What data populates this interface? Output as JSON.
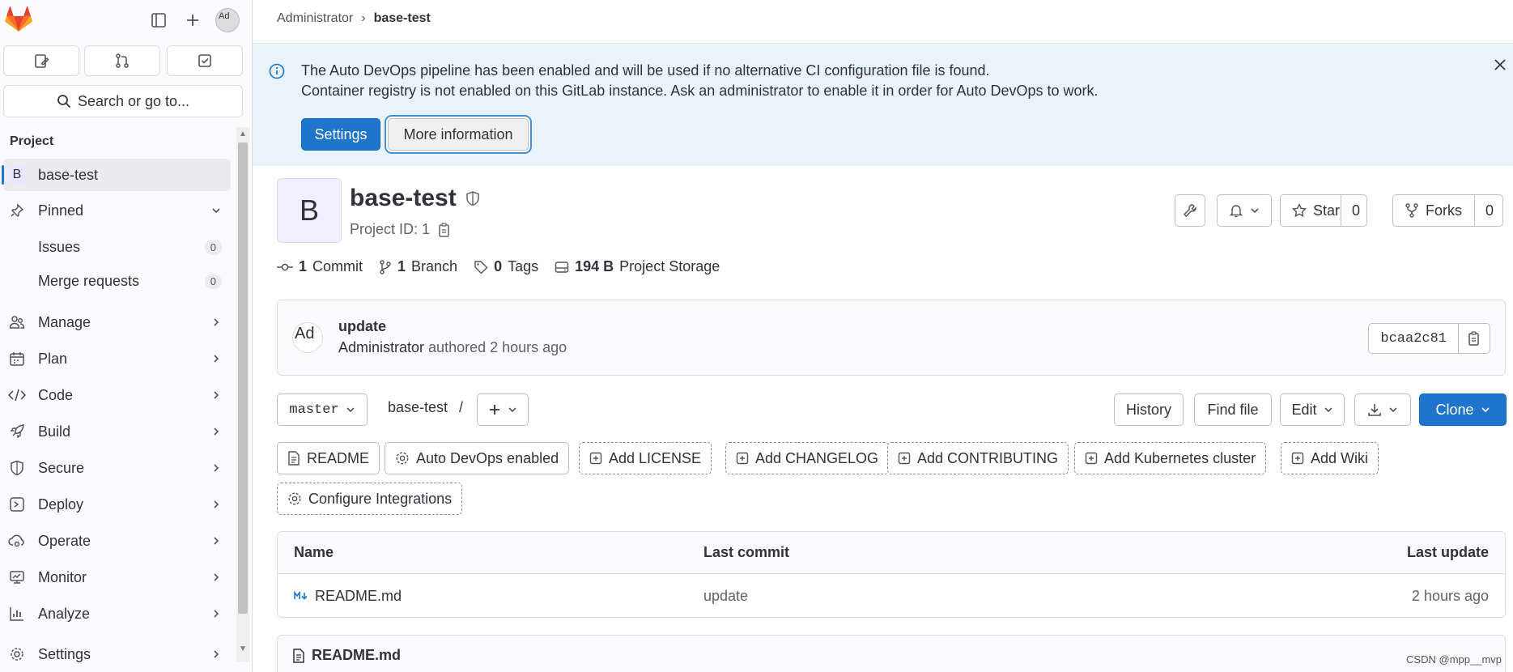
{
  "breadcrumb": {
    "parent": "Administrator",
    "separator": "›",
    "current": "base-test"
  },
  "top": {
    "avatar_alt": "Ad"
  },
  "search": {
    "label": "Search or go to..."
  },
  "sidebar": {
    "section": "Project",
    "project": {
      "letter": "B",
      "name": "base-test"
    },
    "pinned": "Pinned",
    "issues": {
      "label": "Issues",
      "count": "0"
    },
    "merge_requests": {
      "label": "Merge requests",
      "count": "0"
    },
    "items": [
      {
        "label": "Manage"
      },
      {
        "label": "Plan"
      },
      {
        "label": "Code"
      },
      {
        "label": "Build"
      },
      {
        "label": "Secure"
      },
      {
        "label": "Deploy"
      },
      {
        "label": "Operate"
      },
      {
        "label": "Monitor"
      },
      {
        "label": "Analyze"
      },
      {
        "label": "Settings"
      }
    ]
  },
  "alert": {
    "line1": "The Auto DevOps pipeline has been enabled and will be used if no alternative CI configuration file is found.",
    "line2": "Container registry is not enabled on this GitLab instance. Ask an administrator to enable it in order for Auto DevOps to work.",
    "settings_button": "Settings",
    "more_button": "More information"
  },
  "project": {
    "avatar_letter": "B",
    "name": "base-test",
    "id_label": "Project ID: 1",
    "star_label": "Star",
    "star_count": "0",
    "forks_label": "Forks",
    "forks_count": "0"
  },
  "stats": {
    "commits_n": "1",
    "commits_label": "Commit",
    "branches_n": "1",
    "branches_label": "Branch",
    "tags_n": "0",
    "tags_label": "Tags",
    "storage_n": "194 B",
    "storage_label": "Project Storage"
  },
  "last_commit": {
    "avatar_alt": "Ad",
    "title": "update",
    "author": "Administrator",
    "meta": "authored 2 hours ago",
    "sha": "bcaa2c81"
  },
  "repo_toolbar": {
    "branch": "master",
    "path_root": "base-test",
    "path_sep": "/",
    "history": "History",
    "find_file": "Find file",
    "edit": "Edit",
    "clone": "Clone"
  },
  "shortcuts": [
    {
      "label": "README"
    },
    {
      "label": "Auto DevOps enabled"
    },
    {
      "label": "Add LICENSE"
    },
    {
      "label": "Add CHANGELOG"
    },
    {
      "label": "Add CONTRIBUTING"
    },
    {
      "label": "Add Kubernetes cluster"
    },
    {
      "label": "Add Wiki"
    },
    {
      "label": "Configure Integrations"
    }
  ],
  "files_table": {
    "headers": {
      "name": "Name",
      "last_commit": "Last commit",
      "last_update": "Last update"
    },
    "rows": [
      {
        "name": "README.md",
        "commit": "update",
        "updated": "2 hours ago"
      }
    ]
  },
  "readme": {
    "title": "README.md"
  },
  "watermark": "CSDN @mpp__mvp",
  "colors": {
    "primary": "#1f75cb",
    "alert_bg": "#e9f3fc",
    "sidebar_bg": "#fbfafd"
  }
}
